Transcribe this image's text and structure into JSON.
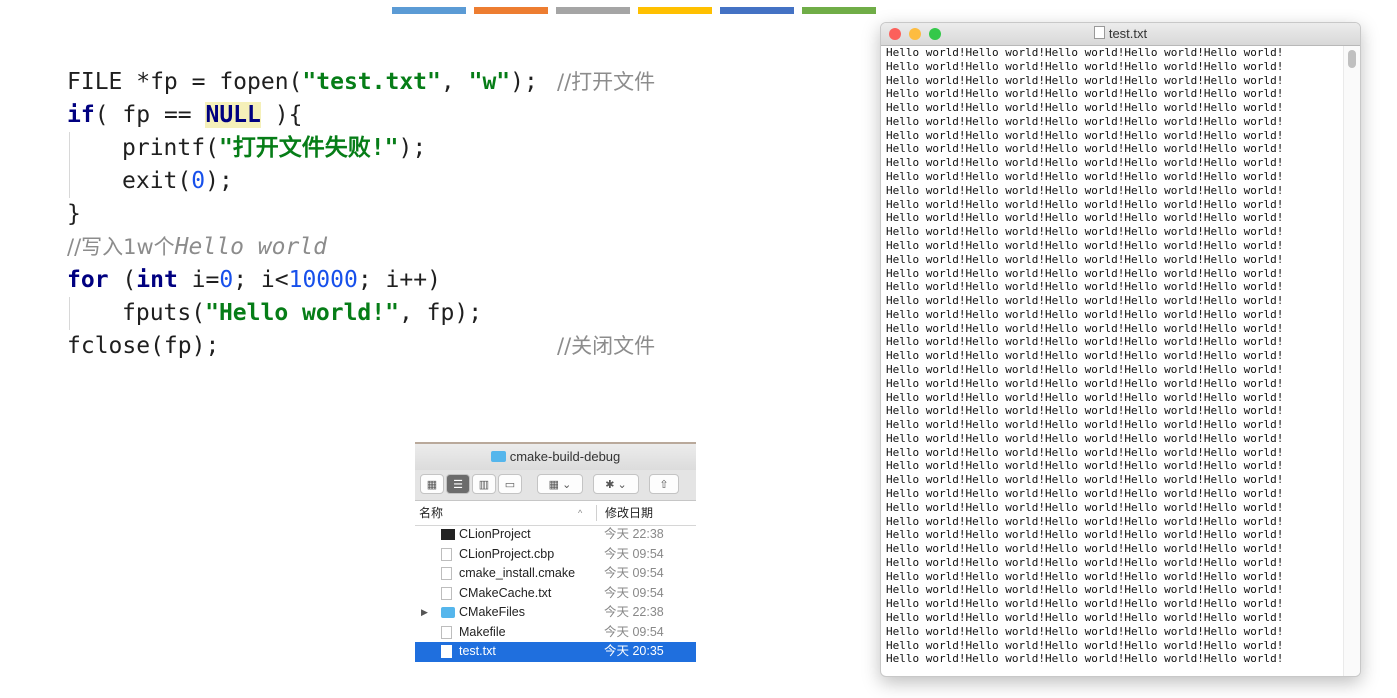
{
  "accent_bars": [
    "#5b9bd5",
    "#ed7d31",
    "#a5a5a5",
    "#ffc000",
    "#4472c4",
    "#70ad47"
  ],
  "code": {
    "l1_a": "FILE *fp = fopen(",
    "l1_str1": "\"test.txt\"",
    "l1_b": ", ",
    "l1_str2": "\"w\"",
    "l1_c": ");",
    "l1_comment": "//打开文件",
    "l2_kw": "if",
    "l2_a": "( fp == ",
    "l2_null": "NULL",
    "l2_b": " ){",
    "l3_a": "printf(",
    "l3_str": "\"打开文件失败!\"",
    "l3_b": ");",
    "l4_a": "exit(",
    "l4_num": "0",
    "l4_b": ");",
    "l5": "}",
    "l6_a": "//写入1w个",
    "l6_b": "Hello world",
    "l7_kw1": "for",
    "l7_a": " (",
    "l7_kw2": "int",
    "l7_b": " i=",
    "l7_num1": "0",
    "l7_c": "; i<",
    "l7_num2": "10000",
    "l7_d": "; i++)",
    "l8_a": "fputs(",
    "l8_str": "\"Hello world!\"",
    "l8_b": ", fp);",
    "l9_a": "fclose(fp);",
    "l9_comment": "//关闭文件"
  },
  "finder": {
    "title": "cmake-build-debug",
    "col_name": "名称",
    "col_date": "修改日期",
    "files": [
      {
        "name": "CLionProject",
        "date": "今天 22:38",
        "icon": "executable-icon"
      },
      {
        "name": "CLionProject.cbp",
        "date": "今天 09:54",
        "icon": "document-icon"
      },
      {
        "name": "cmake_install.cmake",
        "date": "今天 09:54",
        "icon": "document-icon"
      },
      {
        "name": "CMakeCache.txt",
        "date": "今天 09:54",
        "icon": "text-file-icon"
      },
      {
        "name": "CMakeFiles",
        "date": "今天 22:38",
        "icon": "folder-icon"
      },
      {
        "name": "Makefile",
        "date": "今天 09:54",
        "icon": "document-icon"
      },
      {
        "name": "test.txt",
        "date": "今天 20:35",
        "icon": "text-file-icon"
      }
    ],
    "selected_index": 6
  },
  "text_window": {
    "title": "test.txt",
    "line_text": "Hello world!Hello world!Hello world!Hello world!Hello world!",
    "visible_lines": 45
  }
}
